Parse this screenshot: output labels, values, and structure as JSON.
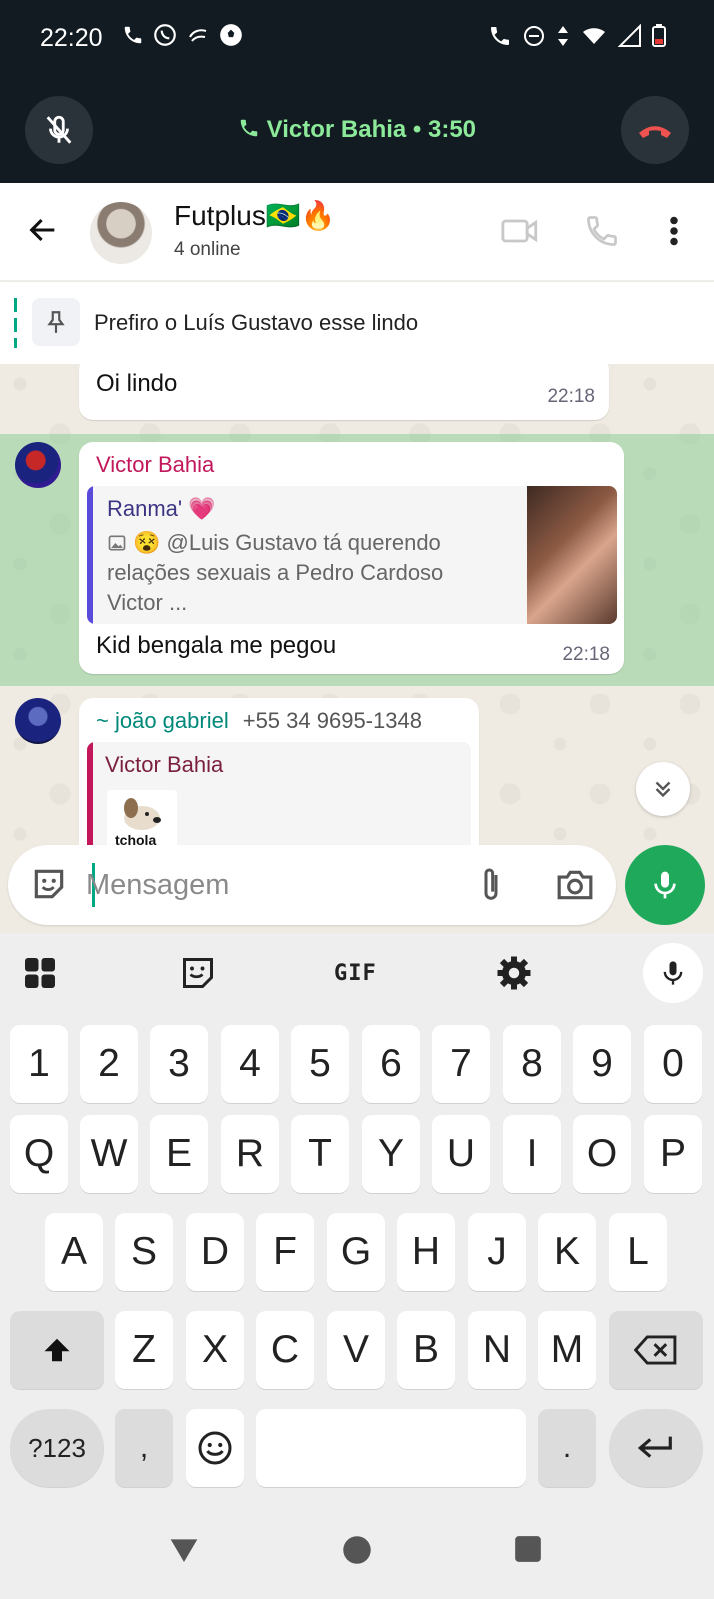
{
  "status_bar": {
    "time": "22:20"
  },
  "call_bar": {
    "label": "Victor Bahia • 3:50",
    "color": "#8ce99a"
  },
  "header": {
    "title": "Futplus🇧🇷🔥",
    "subtitle": "4 online"
  },
  "pinned": {
    "text": "Prefiro o Luís Gustavo esse lindo"
  },
  "messages": [
    {
      "text": "Oi lindo",
      "time": "22:18"
    },
    {
      "sender": "Victor Bahia",
      "sender_color": "#c2185b",
      "quote_author": "Ranma' 💗",
      "quote_author_color": "#3b3584",
      "quote_line1": "😵 @Luis Gustavo tá querendo",
      "quote_line2": "relações sexuais a Pedro Cardoso",
      "quote_line3": "Victor ...",
      "text": "Kid bengala me pegou",
      "time": "22:18"
    },
    {
      "sender": "~ joão gabriel",
      "sender_color": "#00897b",
      "phone": "+55 34 9695-1348",
      "quote_author": "Victor Bahia",
      "quote_author_color": "#7a1f3d",
      "sticker_text": "tchola"
    }
  ],
  "composer": {
    "placeholder": "Mensagem"
  },
  "keyboard": {
    "gif_label": "GIF",
    "row_numbers": [
      "1",
      "2",
      "3",
      "4",
      "5",
      "6",
      "7",
      "8",
      "9",
      "0"
    ],
    "row1": [
      "Q",
      "W",
      "E",
      "R",
      "T",
      "Y",
      "U",
      "I",
      "O",
      "P"
    ],
    "row2": [
      "A",
      "S",
      "D",
      "F",
      "G",
      "H",
      "J",
      "K",
      "L"
    ],
    "row3": [
      "Z",
      "X",
      "C",
      "V",
      "B",
      "N",
      "M"
    ],
    "symbols_label": "?123",
    "comma": ",",
    "period": "."
  }
}
